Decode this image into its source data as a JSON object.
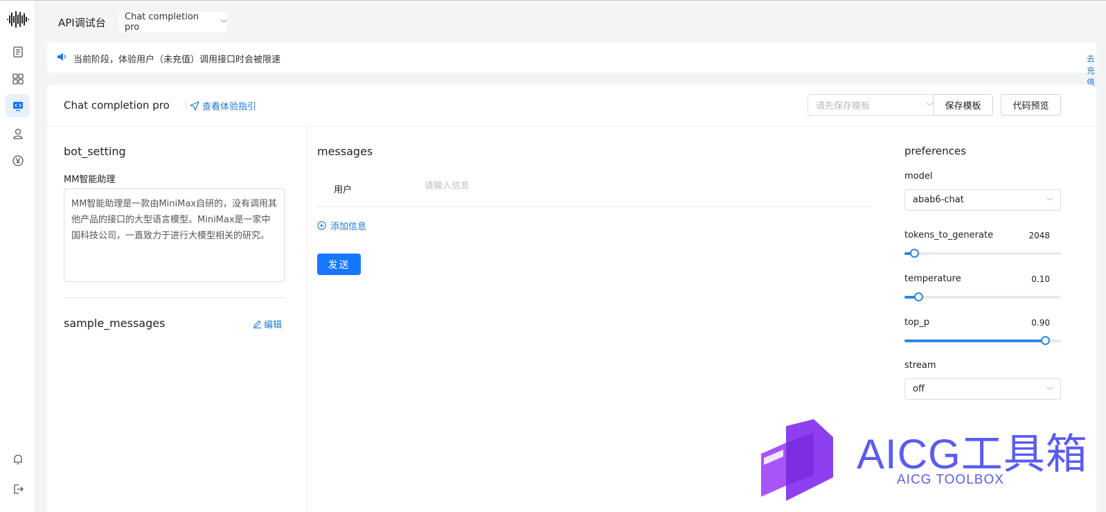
{
  "header": {
    "title": "API调试台",
    "model_select": "Chat completion pro"
  },
  "notice": {
    "text": "当前阶段，体验用户（未充值）调用接口时会被限速",
    "link": "去充值",
    "close": "×"
  },
  "card": {
    "title": "Chat completion pro",
    "guide_link": "查看体验指引",
    "template_placeholder": "请先保存模板",
    "save_template": "保存模板",
    "code_preview": "代码预览"
  },
  "bot_setting": {
    "title": "bot_setting",
    "bot_name": "MM智能助理",
    "bot_content": "MM智能助理是一款由MiniMax自研的，没有调用其他产品的接口的大型语言模型。MiniMax是一家中国科技公司，一直致力于进行大模型相关的研究。"
  },
  "sample_messages": {
    "title": "sample_messages",
    "edit": "编辑"
  },
  "messages": {
    "title": "messages",
    "role": "用户",
    "input_placeholder": "请输入信息",
    "add": "添加信息",
    "send": "发送"
  },
  "preferences": {
    "title": "preferences",
    "model_label": "model",
    "model_value": "abab6-chat",
    "tokens_label": "tokens_to_generate",
    "tokens_value": "2048",
    "tokens_fraction": 0.06,
    "temperature_label": "temperature",
    "temperature_value": "0.10",
    "temperature_fraction": 0.09,
    "top_p_label": "top_p",
    "top_p_value": "0.90",
    "top_p_fraction": 0.9,
    "stream_label": "stream",
    "stream_value": "off"
  },
  "watermark": {
    "main": "AICG工具箱",
    "sub": "AICG TOOLBOX"
  },
  "colors": {
    "accent": "#1677ff",
    "link": "#1f78d1",
    "watermark": "#5a5cf0"
  }
}
